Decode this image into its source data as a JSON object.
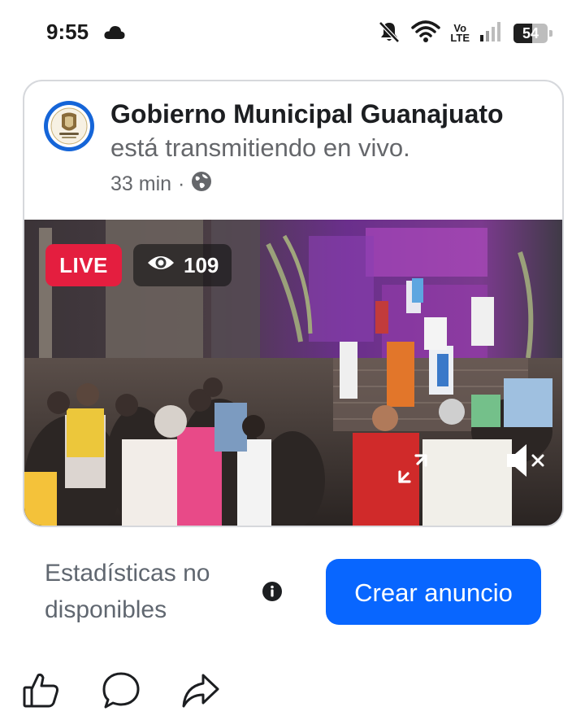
{
  "status_bar": {
    "time": "9:55",
    "network_label_top": "Vo",
    "network_label_bottom": "LTE",
    "battery_percent": "54",
    "battery_level": 0.54,
    "icons": [
      "cloud-icon",
      "mute-notifications-icon",
      "wifi-icon",
      "signal-icon",
      "battery-icon"
    ]
  },
  "post": {
    "page_name": "Gobierno Municipal Guanajuato",
    "description": "está transmitiendo en vivo.",
    "time_ago": "33 min",
    "separator": "·",
    "audience_icon": "globe-icon"
  },
  "video": {
    "live_label": "LIVE",
    "viewer_count": "109",
    "icons": [
      "eye-icon",
      "expand-icon",
      "speaker-muted-icon"
    ]
  },
  "insights": {
    "stats_text": "Estadísticas no disponibles",
    "info_icon": "info-icon",
    "cta_label": "Crear anuncio"
  },
  "actions": [
    "like-icon",
    "comment-icon",
    "share-icon"
  ],
  "colors": {
    "live_red": "#e41e3f",
    "cta_blue": "#0866ff",
    "secondary_text": "#65676b",
    "avatar_ring": "#1565d8"
  }
}
